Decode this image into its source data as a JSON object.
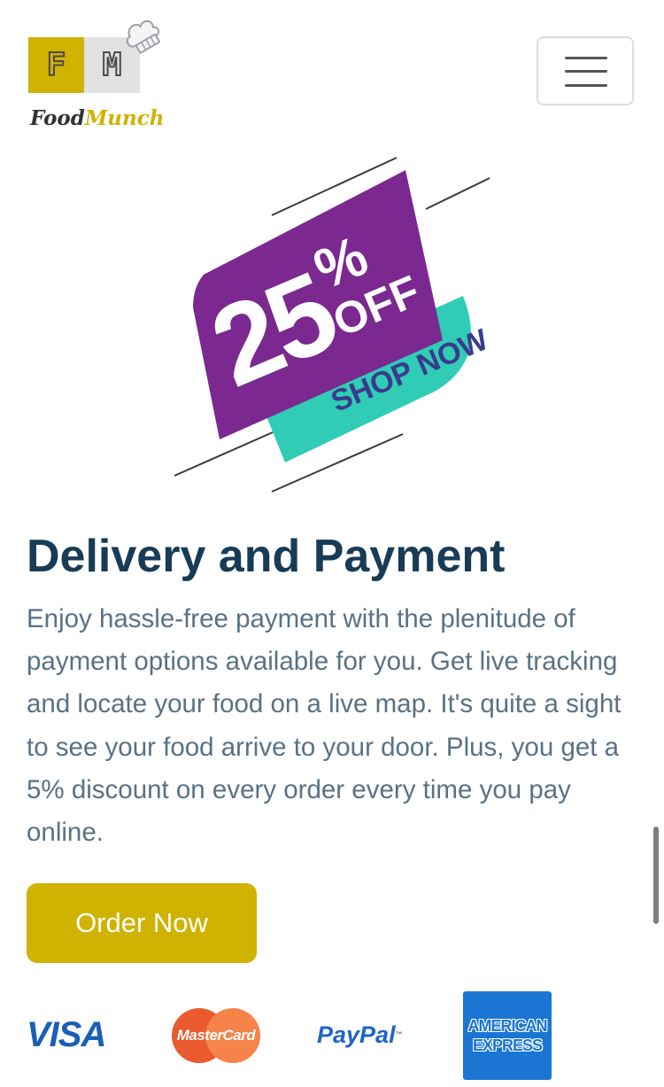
{
  "brand": {
    "mark_left": "F",
    "mark_right": "M",
    "name_part1": "Food",
    "name_part2": "Munch"
  },
  "navbar": {
    "menu_icon": "hamburger-icon"
  },
  "promo": {
    "number": "25",
    "percent": "%",
    "off": "OFF",
    "cta": "SHOP NOW",
    "colors": {
      "purple": "#7b2890",
      "teal": "#30ccb6",
      "cta_text": "#3a3b8a"
    }
  },
  "section": {
    "title": "Delivery and Payment",
    "description": "Enjoy hassle-free payment with the plenitude of payment options available for you. Get live tracking and locate your food on a live map. It's quite a sight to see your food arrive to your door. Plus, you get a 5% discount on every order every time you pay online.",
    "button_label": "Order Now"
  },
  "payments": {
    "visa": "VISA",
    "mastercard": "MasterCard",
    "paypal": "PayPal",
    "paypal_tm": "™",
    "amex_line1": "AMERICAN",
    "amex_line2": "EXPRESS"
  },
  "colors": {
    "accent": "#d0b200",
    "title": "#183b56",
    "body_text": "#5a7184"
  }
}
